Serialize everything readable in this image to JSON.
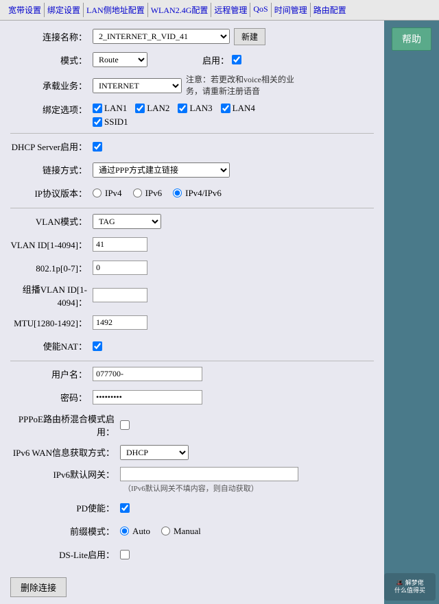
{
  "nav": {
    "items": [
      "宽带设置",
      "绑定设置",
      "LAN侧地址配置",
      "WLAN2.4G配置",
      "远程管理",
      "QoS",
      "时间管理",
      "路由配置"
    ]
  },
  "help": {
    "label": "帮助"
  },
  "form": {
    "connection_name_label": "连接名称：",
    "connection_name_value": "2_INTERNET_R_VID_41",
    "new_btn": "新建",
    "mode_label": "模式：",
    "mode_value": "Route",
    "enable_label": "启用：",
    "service_label": "承载业务：",
    "service_value": "INTERNET",
    "note": "注意：若更改和voice相关的业务，请重新注册语音",
    "binding_label": "绑定选项：",
    "lan1": "LAN1",
    "lan2": "LAN2",
    "lan3": "LAN3",
    "lan4": "LAN4",
    "ssid1": "SSID1",
    "dhcp_label": "DHCP Server启用：",
    "link_label": "链接方式：",
    "link_value": "通过PPP方式建立链接",
    "ip_proto_label": "IP协议版本：",
    "ipv4": "IPv4",
    "ipv6": "IPv6",
    "ipv4ipv6": "IPv4/IPv6",
    "vlan_mode_label": "VLAN模式：",
    "vlan_mode_value": "TAG",
    "vlan_id_label": "VLAN ID[1-4094]：",
    "vlan_id_value": "41",
    "dot1p_label": "802.1p[0-7]：",
    "dot1p_value": "0",
    "group_vlan_label": "组播VLAN ID[1-4094]：",
    "group_vlan_value": "",
    "mtu_label": "MTU[1280-1492]：",
    "mtu_value": "1492",
    "nat_label": "使能NAT：",
    "username_label": "用户名：",
    "username_value": "077700-",
    "password_label": "密码：",
    "password_value": "•••••••••",
    "pppoe_bridge_label": "PPPoE路由桥混合模式启用：",
    "ipv6_wan_label": "IPv6 WAN信息获取方式：",
    "ipv6_wan_value": "DHCP",
    "ipv6_gw_label": "IPv6默认网关：",
    "ipv6_gw_value": "",
    "ipv6_gw_note": "（IPv6默认网关不填内容，则自动获取）",
    "pd_label": "PD使能：",
    "prefix_label": "前缀模式：",
    "prefix_auto": "Auto",
    "prefix_manual": "Manual",
    "dslite_label": "DS-Lite启用：",
    "delete_btn": "删除连接"
  }
}
